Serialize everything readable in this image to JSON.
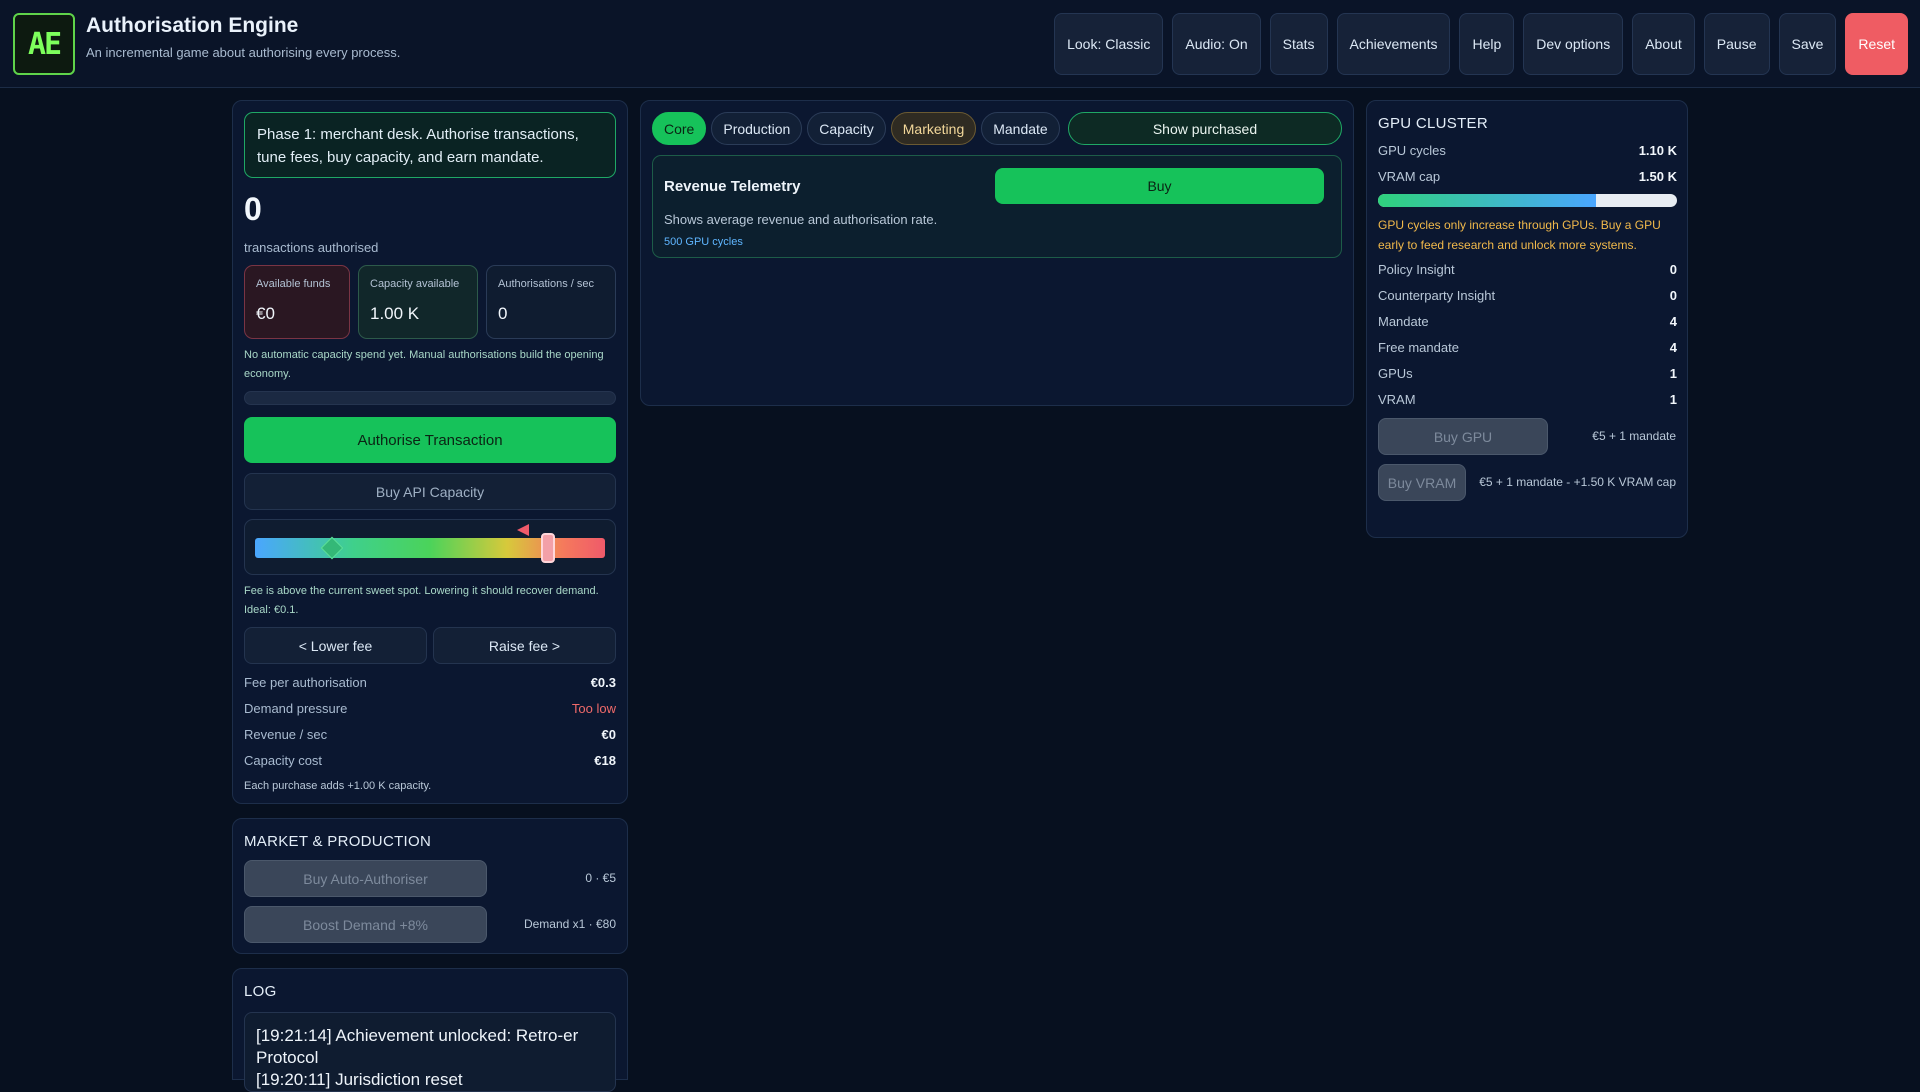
{
  "header": {
    "logo_text": "AE",
    "title": "Authorisation Engine",
    "subtitle": "An incremental game about authorising every process.",
    "nav": [
      {
        "label": "Look: Classic"
      },
      {
        "label": "Audio: On"
      },
      {
        "label": "Stats"
      },
      {
        "label": "Achievements"
      },
      {
        "label": "Help"
      },
      {
        "label": "Dev options"
      },
      {
        "label": "About"
      },
      {
        "label": "Pause"
      },
      {
        "label": "Save"
      },
      {
        "label": "Reset"
      }
    ],
    "reset_color": "#ef5c63"
  },
  "core": {
    "phase_text": "Phase 1: merchant desk. Authorise transactions, tune fees, buy capacity, and earn mandate.",
    "count": "0",
    "count_label": "transactions authorised",
    "stats": [
      {
        "label": "Available funds",
        "value": "€0"
      },
      {
        "label": "Capacity available",
        "value": "1.00 K"
      },
      {
        "label": "Authorisations / sec",
        "value": "0"
      }
    ],
    "auto_note": "No automatic capacity spend yet. Manual authorisations build the opening economy.",
    "authorise_label": "Authorise Transaction",
    "buy_capacity_label": "Buy API Capacity",
    "fee_note": "Fee is above the current sweet spot. Lowering it should recover demand. Ideal: €0.1.",
    "lower_fee_label": "< Lower fee",
    "raise_fee_label": "Raise fee >",
    "rows": [
      {
        "k": "Fee per authorisation",
        "v": "€0.3"
      },
      {
        "k": "Demand pressure",
        "v": "Too low"
      },
      {
        "k": "Revenue / sec",
        "v": "€0"
      },
      {
        "k": "Capacity cost",
        "v": "€18"
      }
    ],
    "capacity_note": "Each purchase adds +1.00 K capacity.",
    "accent_green": "#16c25a"
  },
  "market": {
    "title": "MARKET & PRODUCTION",
    "auto_btn": "Buy Auto-Authoriser",
    "auto_info": "0 · €5",
    "boost_btn": "Boost Demand +8%",
    "boost_info": "Demand x1 · €80"
  },
  "log": {
    "title": "LOG",
    "entries": [
      "[19:21:14] Achievement unlocked: Retro-er Protocol",
      "[19:20:11] Jurisdiction reset"
    ]
  },
  "upgrades": {
    "tabs": [
      {
        "label": "Core"
      },
      {
        "label": "Production"
      },
      {
        "label": "Capacity"
      },
      {
        "label": "Marketing"
      },
      {
        "label": "Mandate"
      }
    ],
    "show_purchased": "Show purchased",
    "item": {
      "name": "Revenue Telemetry",
      "desc": "Shows average revenue and authorisation rate.",
      "cost": "500 GPU cycles",
      "buy_label": "Buy"
    }
  },
  "gpu": {
    "title": "GPU CLUSTER",
    "top_rows": [
      {
        "k": "GPU cycles",
        "v": "1.10 K"
      },
      {
        "k": "VRAM cap",
        "v": "1.50 K"
      }
    ],
    "vram_fill_fraction": 0.73,
    "note": "GPU cycles only increase through GPUs. Buy a GPU early to feed research and unlock more systems.",
    "rows": [
      {
        "k": "Policy Insight",
        "v": "0"
      },
      {
        "k": "Counterparty Insight",
        "v": "0"
      },
      {
        "k": "Mandate",
        "v": "4"
      },
      {
        "k": "Free mandate",
        "v": "4"
      },
      {
        "k": "GPUs",
        "v": "1"
      },
      {
        "k": "VRAM",
        "v": "1"
      }
    ],
    "buy_gpu_label": "Buy GPU",
    "buy_gpu_cost": "€5 + 1 mandate",
    "buy_vram_label": "Buy VRAM",
    "buy_vram_cost": "€5 + 1 mandate - +1.50 K VRAM cap",
    "note_color": "#f1b94b"
  }
}
